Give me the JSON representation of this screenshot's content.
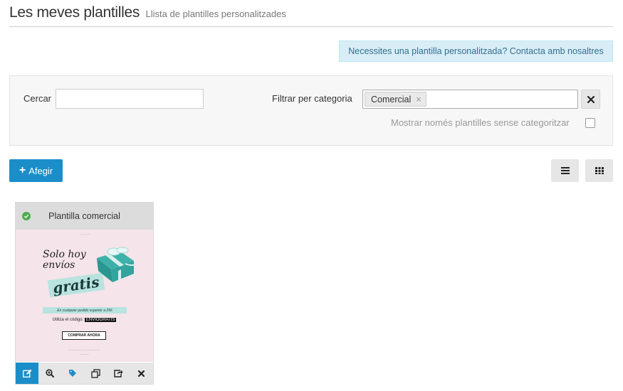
{
  "header": {
    "title": "Les meves plantilles",
    "subtitle": "Llista de plantilles personalitzades"
  },
  "banner": {
    "text": "Necessites una plantilla personalitzada? Contacta amb nosaltres"
  },
  "filters": {
    "search_label": "Cercar",
    "search_value": "",
    "category_label": "Filtrar per categoria",
    "selected_category": "Comercial",
    "uncategorized_label": "Mostrar només plantilles sense categoritzar",
    "uncategorized_checked": false
  },
  "toolbar": {
    "add_label": "Afegir"
  },
  "templates": [
    {
      "title": "Plantilla comercial",
      "status": "check-circle-icon",
      "preview": {
        "headline_line1": "Solo hoy",
        "headline_line2": "envíos",
        "headline_big": "gratis",
        "strip_text": "En cualquier pedido superior a 25€",
        "code_prefix": "Utiliza el código:",
        "code": "ENVIOGRATIS",
        "button": "COMPRAR AHORA"
      },
      "actions": [
        "edit-icon",
        "zoom-icon",
        "tag-icon",
        "duplicate-icon",
        "share-icon",
        "delete-icon"
      ]
    }
  ],
  "colors": {
    "primary": "#1b8ec9",
    "info_bg": "#d9edf7",
    "info_text": "#31708f",
    "status_ok": "#4cae4c",
    "preview_bg": "#f5e4ea",
    "preview_accent": "#b9e3df"
  }
}
